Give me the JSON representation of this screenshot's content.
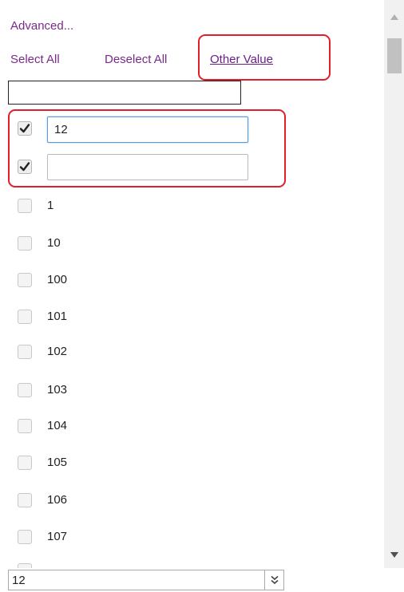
{
  "header": {
    "advanced_label": "Advanced...",
    "select_all_label": "Select All",
    "deselect_all_label": "Deselect All",
    "other_value_label": "Other Value"
  },
  "filter": {
    "value": ""
  },
  "custom_rows": [
    {
      "checked": true,
      "value": "12"
    },
    {
      "checked": true,
      "value": ""
    }
  ],
  "items": [
    {
      "label": "1",
      "checked": false
    },
    {
      "label": "10",
      "checked": false
    },
    {
      "label": "100",
      "checked": false
    },
    {
      "label": "101",
      "checked": false
    },
    {
      "label": "102",
      "checked": false
    },
    {
      "label": "103",
      "checked": false
    },
    {
      "label": "104",
      "checked": false
    },
    {
      "label": "105",
      "checked": false
    },
    {
      "label": "106",
      "checked": false
    },
    {
      "label": "107",
      "checked": false
    }
  ],
  "bottom": {
    "value": "12"
  },
  "icons": {
    "checkmark": "checkmark-icon",
    "scroll_up": "triangle-up-icon",
    "scroll_down": "triangle-down-icon",
    "expand": "double-chevron-down-icon"
  },
  "colors": {
    "link": "#7a2a8a",
    "highlight": "#e21e2a",
    "focus": "#5b9bd5"
  }
}
